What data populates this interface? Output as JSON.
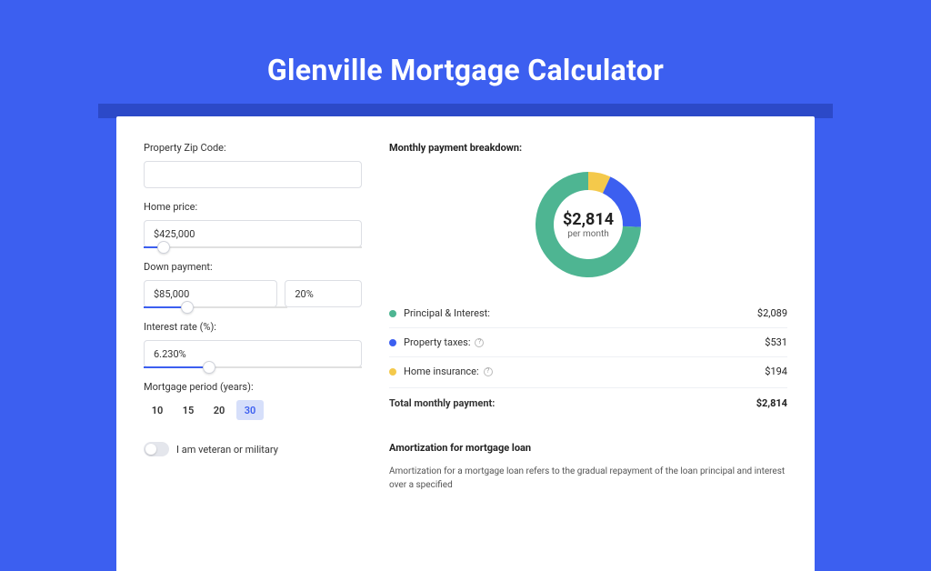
{
  "title": "Glenville Mortgage Calculator",
  "form": {
    "zip_label": "Property Zip Code:",
    "zip_value": "",
    "price_label": "Home price:",
    "price_value": "$425,000",
    "price_slider_pct": 9,
    "down_label": "Down payment:",
    "down_value": "$85,000",
    "down_pct_value": "20%",
    "down_slider_pct": 20,
    "rate_label": "Interest rate (%):",
    "rate_value": "6.230%",
    "rate_slider_pct": 30,
    "period_label": "Mortgage period (years):",
    "periods": [
      "10",
      "15",
      "20",
      "30"
    ],
    "period_active": "30",
    "veteran_label": "I am veteran or military"
  },
  "breakdown": {
    "title": "Monthly payment breakdown:",
    "center_amount": "$2,814",
    "center_sub": "per month",
    "items": [
      {
        "label": "Principal & Interest:",
        "value": "$2,089",
        "color": "green",
        "info": false
      },
      {
        "label": "Property taxes:",
        "value": "$531",
        "color": "blue",
        "info": true
      },
      {
        "label": "Home insurance:",
        "value": "$194",
        "color": "yellow",
        "info": true
      }
    ],
    "total_label": "Total monthly payment:",
    "total_value": "$2,814"
  },
  "amort": {
    "title": "Amortization for mortgage loan",
    "text": "Amortization for a mortgage loan refers to the gradual repayment of the loan principal and interest over a specified"
  },
  "chart_data": {
    "type": "pie",
    "title": "Monthly payment breakdown",
    "series": [
      {
        "name": "Principal & Interest",
        "value": 2089,
        "color": "#4eb592"
      },
      {
        "name": "Property taxes",
        "value": 531,
        "color": "#3c5ff0"
      },
      {
        "name": "Home insurance",
        "value": 194,
        "color": "#f4c94b"
      }
    ],
    "total": 2814,
    "donut": true
  }
}
